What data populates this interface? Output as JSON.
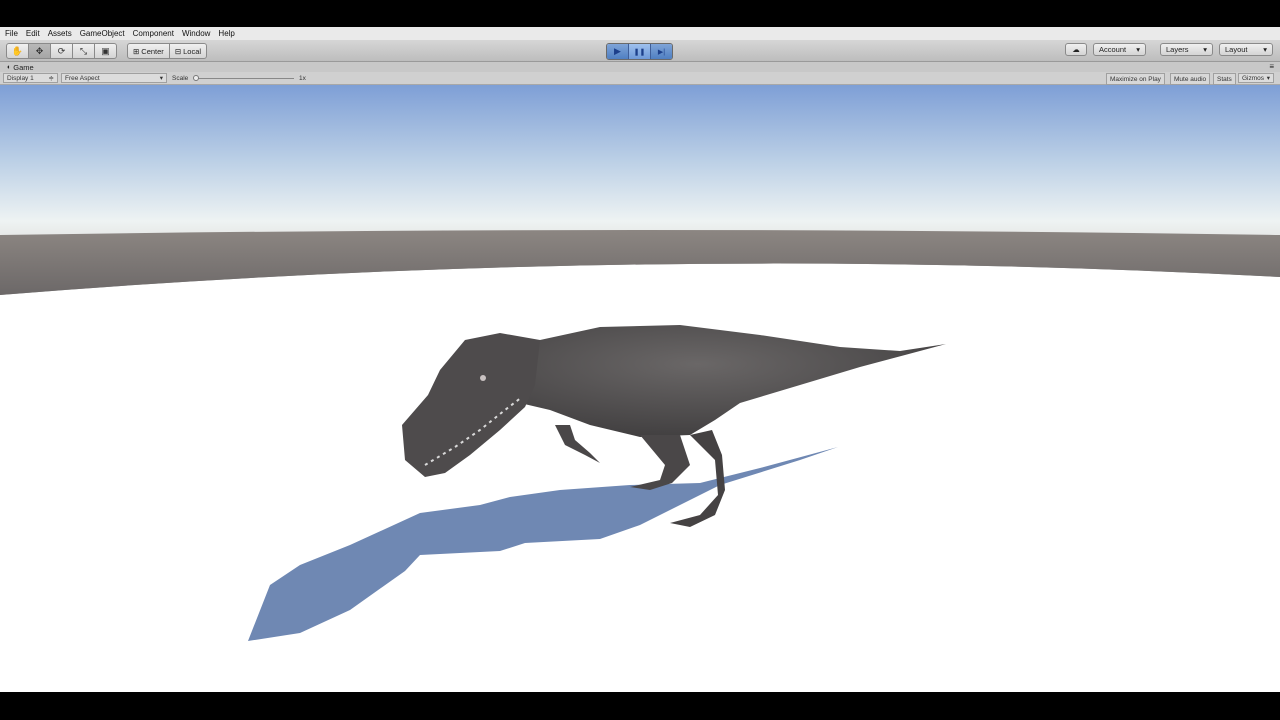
{
  "menu": [
    "File",
    "Edit",
    "Assets",
    "GameObject",
    "Component",
    "Window",
    "Help"
  ],
  "toolbar": {
    "tools": [
      {
        "name": "hand-tool",
        "glyph": "✋"
      },
      {
        "name": "move-tool",
        "glyph": "✥"
      },
      {
        "name": "rotate-tool",
        "glyph": "⟳"
      },
      {
        "name": "scale-tool",
        "glyph": "⤡"
      },
      {
        "name": "rect-tool",
        "glyph": "▣"
      }
    ],
    "pivot_label": "Center",
    "space_label": "Local",
    "play_glyph": "▶",
    "pause_glyph": "❚❚",
    "step_glyph": "▶|",
    "account_label": "Account",
    "layers_label": "Layers",
    "layout_label": "Layout"
  },
  "game_panel": {
    "tab_title": "Game",
    "display": "Display 1",
    "aspect": "Free Aspect",
    "scale_label": "Scale",
    "scale_value": "1x",
    "maximize_label": "Maximize on Play",
    "mute_label": "Mute audio",
    "stats_label": "Stats",
    "gizmos_label": "Gizmos"
  },
  "scene": {
    "sky_top": "#7d9fd4",
    "sky_horizon": "#eef3f4",
    "horizon_band": "#6f6a6a",
    "ground": "#ffffff",
    "shadow": "#6e87b2",
    "creature": "#5a5757"
  }
}
